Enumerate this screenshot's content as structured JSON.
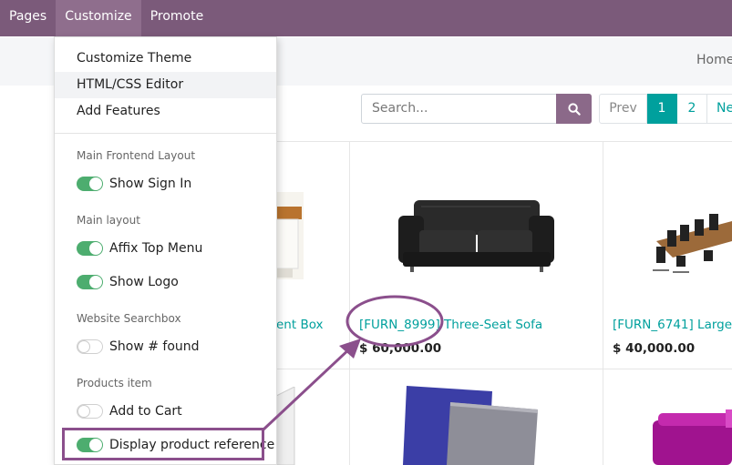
{
  "topbar": {
    "items": [
      "Pages",
      "Customize",
      "Promote"
    ]
  },
  "breadcrumb": {
    "home": "Home"
  },
  "search": {
    "placeholder": "Search..."
  },
  "pager": {
    "prev": "Prev",
    "pages": [
      "1",
      "2"
    ],
    "next": "Ne",
    "current": "1"
  },
  "dropdown": {
    "items": [
      "Customize Theme",
      "HTML/CSS Editor",
      "Add Features"
    ],
    "sections": [
      {
        "header": "Main Frontend Layout",
        "toggles": [
          {
            "label": "Show Sign In",
            "on": true
          }
        ]
      },
      {
        "header": "Main layout",
        "toggles": [
          {
            "label": "Affix Top Menu",
            "on": true
          },
          {
            "label": "Show Logo",
            "on": true
          }
        ]
      },
      {
        "header": "Website Searchbox",
        "toggles": [
          {
            "label": "Show # found",
            "on": false
          }
        ]
      },
      {
        "header": "Products item",
        "toggles": [
          {
            "label": "Add to Cart",
            "on": false
          },
          {
            "label": "Display product reference",
            "on": true
          }
        ]
      }
    ]
  },
  "products": [
    {
      "title": "ent Box",
      "price": ""
    },
    {
      "title": "[FURN_8999] Three-Seat Sofa",
      "price": "$ 60,000.00"
    },
    {
      "title": "[FURN_6741] Large M",
      "price": "$ 40,000.00"
    }
  ],
  "colors": {
    "topbar": "#7b5a7a",
    "accent": "#00a09d",
    "toggle_on": "#4dad6f",
    "annotation": "#8b4f8c"
  }
}
